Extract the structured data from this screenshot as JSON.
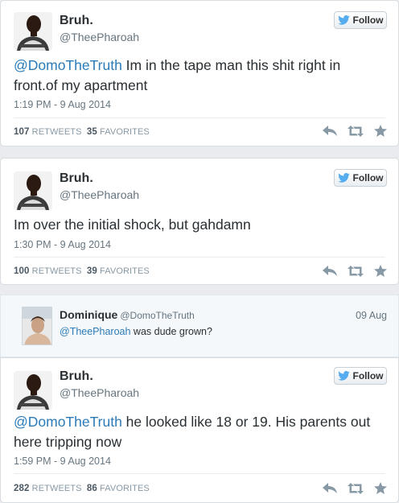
{
  "tweets": [
    {
      "name": "Bruh.",
      "handle": "@TheePharoah",
      "follow_label": "Follow",
      "text_mention": "@DomoTheTruth",
      "text_rest": " Im in the tape man this shit right in front.of my apartment",
      "date": "1:19 PM - 9 Aug 2014",
      "retweets": "107",
      "retweets_label": "RETWEETS",
      "favorites": "35",
      "favorites_label": "FAVORITES"
    },
    {
      "name": "Bruh.",
      "handle": "@TheePharoah",
      "follow_label": "Follow",
      "text_rest": "Im over the initial shock, but gahdamn",
      "date": "1:30 PM - 9 Aug 2014",
      "retweets": "100",
      "retweets_label": "RETWEETS",
      "favorites": "39",
      "favorites_label": "FAVORITES"
    },
    {
      "name": "Bruh.",
      "handle": "@TheePharoah",
      "follow_label": "Follow",
      "text_mention": "@DomoTheTruth",
      "text_rest": " he looked like 18 or 19. His parents out here tripping now",
      "date": "1:59 PM - 9 Aug 2014",
      "retweets": "282",
      "retweets_label": "RETWEETS",
      "favorites": "86",
      "favorites_label": "FAVORITES"
    }
  ],
  "reply": {
    "name": "Dominique",
    "handle": "@DomoTheTruth",
    "text_mention": "@TheePharoah",
    "text_rest": " was dude grown?",
    "date": "09 Aug"
  },
  "icons": [
    "twitter-bird-icon",
    "reply-icon",
    "retweet-icon",
    "favorite-star-icon"
  ],
  "colors": {
    "link": "#2b7bb9",
    "bird": "#55acee",
    "muted": "#66757f",
    "action": "#8899a6"
  }
}
